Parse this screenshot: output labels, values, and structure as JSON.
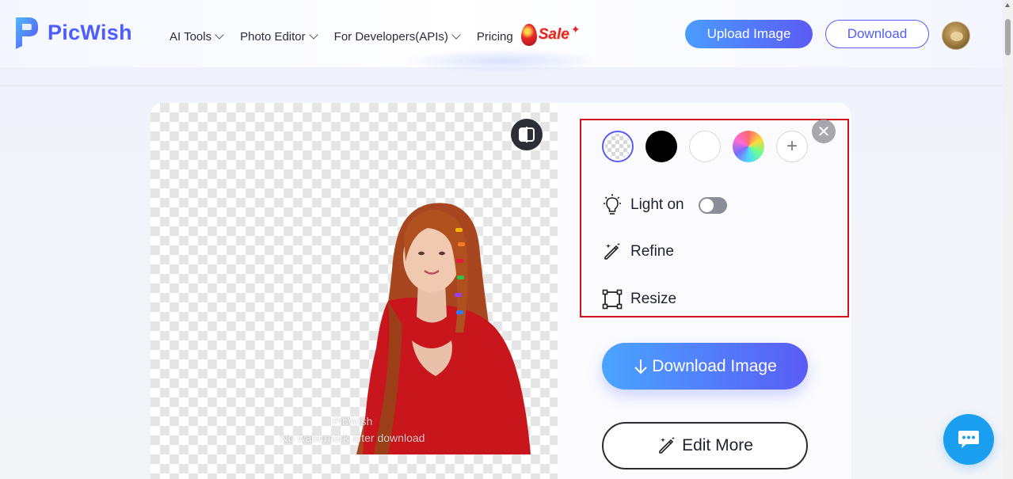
{
  "header": {
    "logo_text": "PicWish",
    "nav": [
      {
        "label": "AI Tools",
        "has_dropdown": true
      },
      {
        "label": "Photo Editor",
        "has_dropdown": true
      },
      {
        "label": "For Developers(APIs)",
        "has_dropdown": true
      },
      {
        "label": "Pricing",
        "has_dropdown": false
      }
    ],
    "sale_label": "Sale",
    "upload_button": "Upload Image",
    "download_button": "Download"
  },
  "canvas": {
    "watermark_line1": "PicWish",
    "watermark_line2": "No watermark after download"
  },
  "panel": {
    "swatches": [
      "transparent",
      "#000000",
      "#ffffff",
      "rainbow",
      "add"
    ],
    "light_label": "Light on",
    "light_on": false,
    "refine_label": "Refine",
    "resize_label": "Resize",
    "download_image_label": "Download Image",
    "edit_more_label": "Edit More"
  },
  "colors": {
    "brand": "#4f5dff",
    "highlight_box": "#d0121b",
    "chat": "#1a9ff0"
  }
}
